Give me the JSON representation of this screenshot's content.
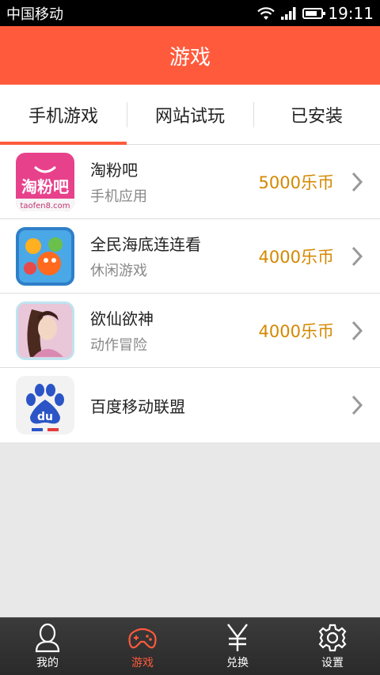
{
  "status_bar": {
    "carrier": "中国移动",
    "time": "19:11"
  },
  "header": {
    "title": "游戏"
  },
  "tabs": [
    {
      "label": "手机游戏",
      "active": true
    },
    {
      "label": "网站试玩",
      "active": false
    },
    {
      "label": "已安装",
      "active": false
    }
  ],
  "apps": [
    {
      "name": "淘粉吧",
      "category": "手机应用",
      "price": "5000乐币",
      "icon": "taofen8-app-icon"
    },
    {
      "name": "全民海底连连看",
      "category": "休闲游戏",
      "price": "4000乐币",
      "icon": "sea-link-game-icon"
    },
    {
      "name": "欲仙欲神",
      "category": "动作冒险",
      "price": "4000乐币",
      "icon": "fairy-game-icon"
    },
    {
      "name": "百度移动联盟",
      "category": "",
      "price": "",
      "icon": "baidu-paw-icon"
    }
  ],
  "icon_texts": {
    "taofen_logo": "淘粉吧",
    "taofen_url": "taofen8.com",
    "baidu_logo": "du"
  },
  "bottom_nav": [
    {
      "label": "我的",
      "icon": "person-icon",
      "active": false
    },
    {
      "label": "游戏",
      "icon": "gamepad-icon",
      "active": true
    },
    {
      "label": "兑换",
      "icon": "yen-icon",
      "active": false
    },
    {
      "label": "设置",
      "icon": "gear-icon",
      "active": false
    }
  ],
  "colors": {
    "accent": "#ff5a3c",
    "price": "#d48800"
  }
}
